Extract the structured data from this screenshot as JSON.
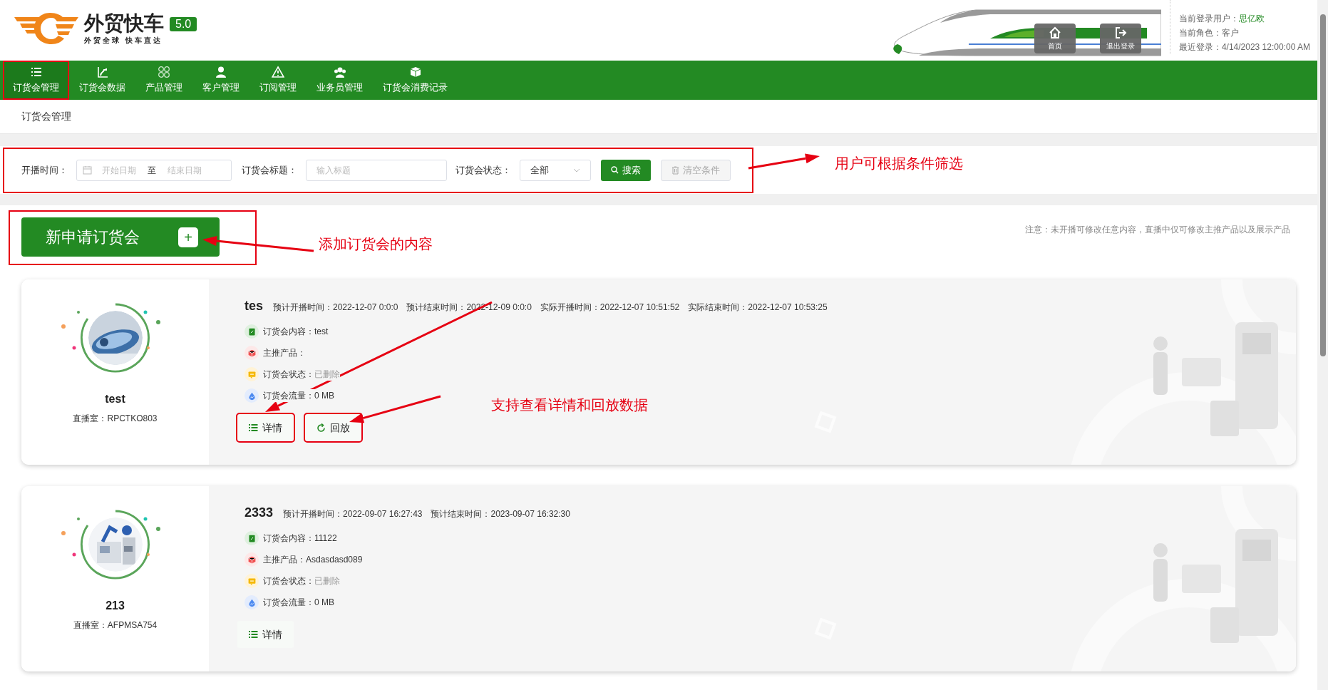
{
  "logo": {
    "title": "外贸快车",
    "slogan": "外贸全球 快车直达",
    "version": "5.0"
  },
  "header_buttons": [
    {
      "label": "首页",
      "kind": "home"
    },
    {
      "label": "退出登录",
      "kind": "logout"
    }
  ],
  "user_info": [
    {
      "label": "当前登录用户：",
      "value": "思亿欧",
      "highlight": true
    },
    {
      "label": "当前角色：",
      "value": "客户",
      "highlight": false
    },
    {
      "label": "最近登录：",
      "value": "4/14/2023 12:00:00 AM",
      "highlight": false
    }
  ],
  "nav": [
    {
      "label": "订货会管理",
      "selected": true,
      "annotated": true
    },
    {
      "label": "订货会数据",
      "selected": false,
      "annotated": false
    },
    {
      "label": "产品管理",
      "selected": false,
      "annotated": false
    },
    {
      "label": "客户管理",
      "selected": false,
      "annotated": false
    },
    {
      "label": "订阅管理",
      "selected": false,
      "annotated": false
    },
    {
      "label": "业务员管理",
      "selected": false,
      "annotated": false
    },
    {
      "label": "订货会消费记录",
      "selected": false,
      "annotated": false
    }
  ],
  "breadcrumb": "订货会管理",
  "filter": {
    "annotated": true,
    "date_label": "开播时间：",
    "start_placeholder": "开始日期",
    "separator": "至",
    "end_placeholder": "结束日期",
    "title_label": "订货会标题：",
    "title_placeholder": "输入标题",
    "status_label": "订货会状态：",
    "status_value": "全部",
    "search_button": "搜索",
    "clear_button": "清空条件"
  },
  "new_button": {
    "label": "新申请订货会",
    "symbol": "+",
    "annotated": true
  },
  "note": "注意：未开播可修改任意内容，直播中仅可修改主推产品以及展示产品",
  "meetings": [
    {
      "name": "test",
      "room": "直播室：RPCTKO803",
      "title": "tes",
      "times": [
        {
          "label": "预计开播时间：",
          "value": "2022-12-07 0:0:0"
        },
        {
          "label": "预计结束时间：",
          "value": "2022-12-09 0:0:0"
        },
        {
          "label": "实际开播时间：",
          "value": "2022-12-07 10:51:52"
        },
        {
          "label": "实际结束时间：",
          "value": "2022-12-07 10:53:25"
        }
      ],
      "info": [
        {
          "kind": "content",
          "label": "订货会内容：",
          "value": "test"
        },
        {
          "kind": "product",
          "label": "主推产品："
        },
        {
          "kind": "status",
          "label": "订货会状态：",
          "value": "已删除"
        },
        {
          "kind": "traffic",
          "label": "订货会流量：",
          "value": "0 MB"
        }
      ],
      "actions": [
        {
          "kind": "detail",
          "label": "详情",
          "annotated": true
        },
        {
          "kind": "replay",
          "label": "回放",
          "annotated": true
        }
      ]
    },
    {
      "name": "213",
      "room": "直播室：AFPMSA754",
      "title": "2333",
      "times": [
        {
          "label": "预计开播时间：",
          "value": "2022-09-07 16:27:43"
        },
        {
          "label": "预计结束时间：",
          "value": "2023-09-07 16:32:30"
        }
      ],
      "info": [
        {
          "kind": "content",
          "label": "订货会内容：",
          "value": "11122"
        },
        {
          "kind": "product",
          "label": "主推产品：",
          "value": "Asdasdasd089"
        },
        {
          "kind": "status",
          "label": "订货会状态：",
          "value": "已删除"
        },
        {
          "kind": "traffic",
          "label": "订货会流量：",
          "value": "0 MB"
        }
      ],
      "actions": [
        {
          "kind": "detail",
          "label": "详情",
          "annotated": false
        }
      ]
    }
  ],
  "annotations": [
    {
      "text": "用户可根据条件筛选"
    },
    {
      "text": "添加订货会的内容"
    },
    {
      "text": "支持查看详情和回放数据"
    }
  ]
}
